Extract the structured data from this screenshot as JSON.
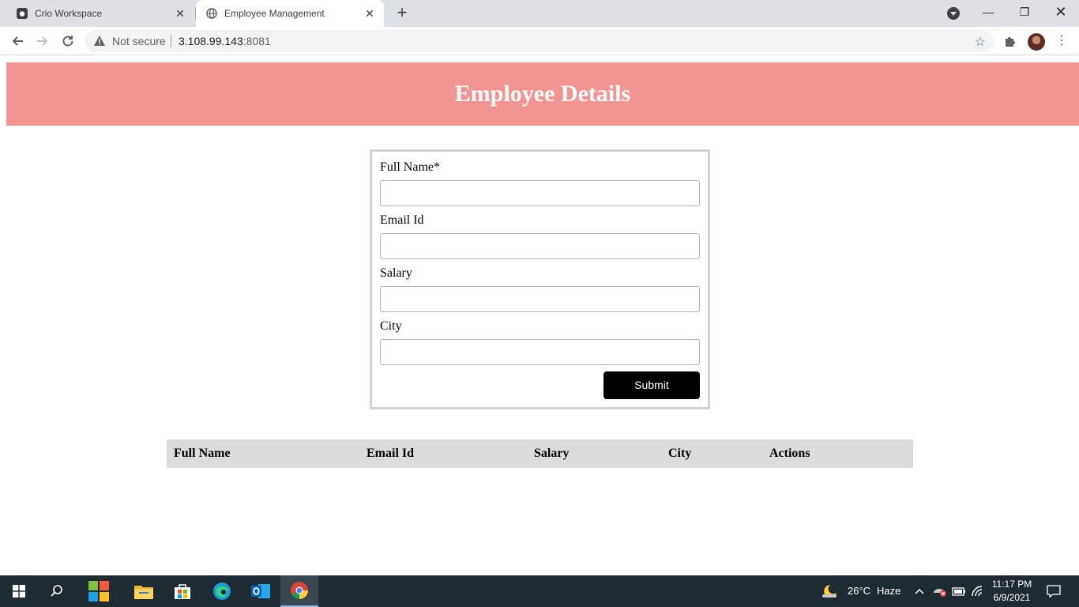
{
  "browser": {
    "tabs": [
      {
        "title": "Crio Workspace",
        "active": false
      },
      {
        "title": "Employee Management",
        "active": true
      }
    ],
    "new_tab_glyph": "+",
    "address": {
      "security_text": "Not secure",
      "host": "3.108.99.143",
      "port": ":8081"
    },
    "icons": [
      "back-arrow-icon",
      "forward-arrow-icon",
      "reload-icon",
      "warning-icon",
      "star-icon",
      "extensions-icon",
      "kebab-menu-icon"
    ]
  },
  "page": {
    "title": "Employee Details",
    "form": {
      "fields": [
        {
          "label": "Full Name*",
          "value": "",
          "placeholder": ""
        },
        {
          "label": "Email Id",
          "value": "",
          "placeholder": ""
        },
        {
          "label": "Salary",
          "value": "",
          "placeholder": ""
        },
        {
          "label": "City",
          "value": "",
          "placeholder": ""
        }
      ],
      "submit_label": "Submit"
    },
    "table": {
      "columns": [
        "Full Name",
        "Email Id",
        "Salary",
        "City",
        "Actions"
      ],
      "rows": []
    },
    "colors": {
      "header_bg": "#f29492",
      "table_header_bg": "#dcdcdc",
      "submit_bg": "#000000"
    }
  },
  "taskbar": {
    "weather": {
      "temp": "26°C",
      "condition": "Haze"
    },
    "clock": {
      "time": "11:17 PM",
      "date": "6/9/2021"
    }
  }
}
